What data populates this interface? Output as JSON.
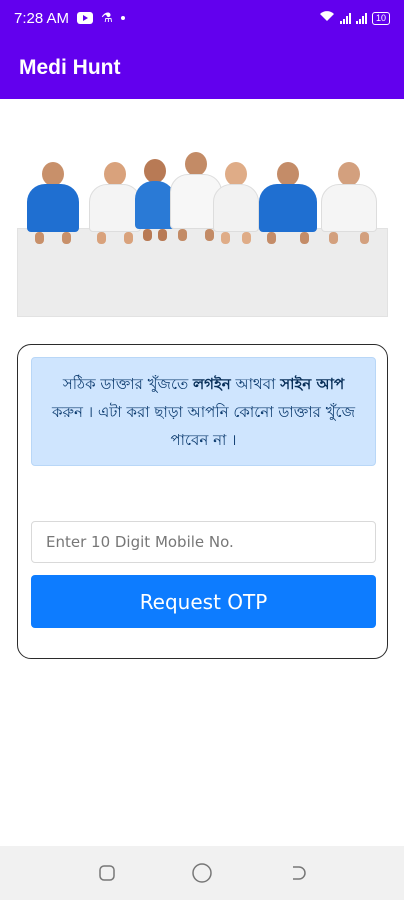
{
  "status_bar": {
    "time": "7:28 AM",
    "icons": [
      "youtube-icon",
      "flask-icon",
      "dot-icon",
      "wifi-icon",
      "signal-icon",
      "battery-icon"
    ],
    "battery": "10"
  },
  "app_bar": {
    "title": "Medi Hunt"
  },
  "hero": {
    "image": "doctors-group-illustration"
  },
  "login_card": {
    "info": {
      "part1": "সঠিক ডাক্তার খুঁজতে ",
      "bold1": "লগইন",
      "part2": " আথবা ",
      "bold2": "সাইন আপ",
      "part3": " করুন । এটা করা ছাড়া আপনি কোনো ডাক্তার খুঁজে পাবেন না ।"
    },
    "mobile_input": {
      "placeholder": "Enter 10 Digit Mobile No.",
      "value": ""
    },
    "request_otp_label": "Request OTP"
  },
  "nav_bar": {
    "buttons": [
      "recents-icon",
      "home-icon",
      "back-icon"
    ]
  },
  "colors": {
    "primary": "#6200ee",
    "button": "#0d7cff",
    "info_bg": "#cfe5fe"
  }
}
